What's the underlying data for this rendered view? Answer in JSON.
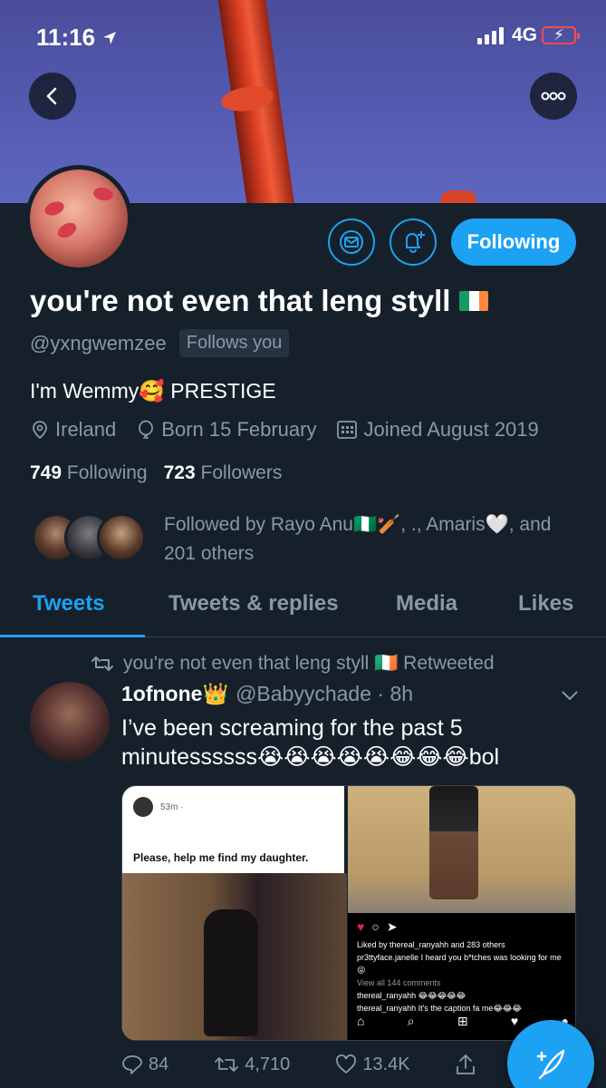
{
  "status_bar": {
    "time": "11:16",
    "network": "4G"
  },
  "profile": {
    "name": "you're not even that leng styll",
    "handle": "@yxngwemzee",
    "follows_you_badge": "Follows you",
    "bio": "I'm Wemmy🥰 PRESTIGE",
    "location": "Ireland",
    "birthday": "Born 15 February",
    "joined": "Joined August 2019",
    "following_count": "749",
    "following_label": "Following",
    "followers_count": "723",
    "followers_label": "Followers",
    "followed_by_text": "Followed by Rayo Anu🇳🇬🏏, ., Amaris🤍, and 201 others",
    "following_button": "Following",
    "flag_colors": [
      "#169b62",
      "#ffffff",
      "#ff883e"
    ]
  },
  "tabs": [
    "Tweets",
    "Tweets & replies",
    "Media",
    "Likes"
  ],
  "tweet": {
    "retweet_line": "you're not even that leng styll 🇮🇪 Retweeted",
    "author_name": "1ofnone👑",
    "author_handle": "@Babyychade · 8h",
    "text": "I’ve been screaming for the past 5 minutessssss😭😭😭😭😭😂😂😂bol",
    "media_left": {
      "time": "53m ·",
      "post_text": "Please, help me find my daughter."
    },
    "media_right": {
      "liked_by": "Liked by thereal_ranyahh and 283 others",
      "comment": "pr3ttyface.janelle I heard you b*tches was looking for me😜",
      "view_all": "View all 144 comments",
      "reply_1": "thereal_ranyahh 😂😂😂😂😂",
      "reply_2": "thereal_ranyahh It's the caption fa me😂😂😂"
    },
    "replies": "84",
    "retweets": "4,710",
    "likes": "13.4K"
  },
  "icons": {
    "back": "chevron-left-icon",
    "more": "more-icon",
    "mail": "mail-icon",
    "bell": "bell-plus-icon",
    "location": "location-pin-icon",
    "birthday": "balloon-icon",
    "calendar": "calendar-icon",
    "compose": "compose-tweet-icon"
  },
  "colors": {
    "accent": "#1da1f2",
    "background": "#15202b",
    "muted": "#8899a6"
  }
}
